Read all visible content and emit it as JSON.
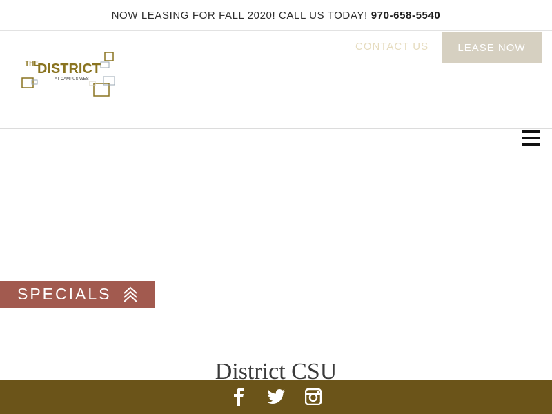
{
  "announcement": {
    "text": "NOW LEASING FOR FALL 2020! CALL US TODAY!",
    "phone": "970-658-5540"
  },
  "logo": {
    "line1": "THE",
    "line2": "DISTRICT",
    "line3": "AT CAMPUS WEST",
    "colors": {
      "gold": "#8a7420",
      "dark": "#3a3a3a"
    }
  },
  "nav": {
    "contact_label": "CONTACT US",
    "lease_label": "LEASE NOW"
  },
  "specials": {
    "label": "SPECIALS"
  },
  "main": {
    "title": "District CSU"
  },
  "footer": {
    "icons": [
      "facebook-icon",
      "twitter-icon",
      "instagram-icon"
    ]
  },
  "colors": {
    "footer_bg": "#6b5419",
    "specials_bg": "#a25a4f",
    "lease_bg": "#d6d0c1",
    "contact_text": "#e6dcbf"
  }
}
